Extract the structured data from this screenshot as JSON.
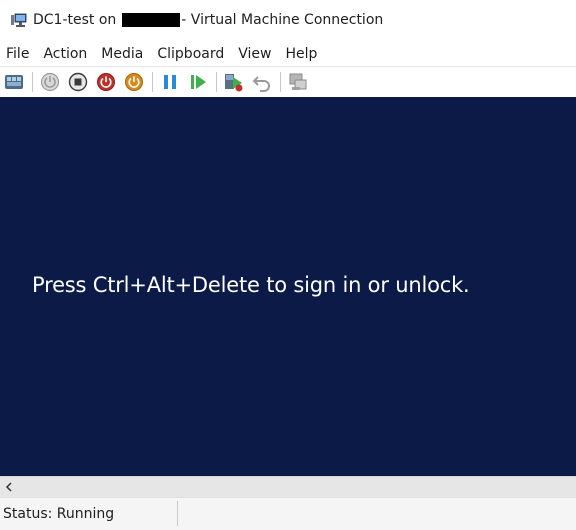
{
  "window": {
    "title_prefix": "DC1-test on",
    "title_suffix": "- Virtual Machine Connection"
  },
  "menu": {
    "items": [
      "File",
      "Action",
      "Media",
      "Clipboard",
      "View",
      "Help"
    ]
  },
  "toolbar": {
    "buttons": [
      {
        "name": "ctrl-alt-del-icon"
      },
      {
        "name": "start-icon"
      },
      {
        "name": "turn-off-icon"
      },
      {
        "name": "shutdown-icon"
      },
      {
        "name": "save-icon"
      },
      {
        "name": "pause-icon"
      },
      {
        "name": "resume-icon"
      },
      {
        "name": "checkpoint-icon"
      },
      {
        "name": "revert-icon"
      },
      {
        "name": "enhanced-session-icon"
      }
    ],
    "colors": {
      "gray": "#9a9a9a",
      "dark": "#3a3a3a",
      "red": "#c0312e",
      "orange": "#d98a1a",
      "blue": "#2a8ad4",
      "green": "#3fb04a"
    }
  },
  "screen": {
    "message": "Press Ctrl+Alt+Delete to sign in or unlock.",
    "background": "#0c1a48"
  },
  "status": {
    "text": "Status: Running"
  }
}
